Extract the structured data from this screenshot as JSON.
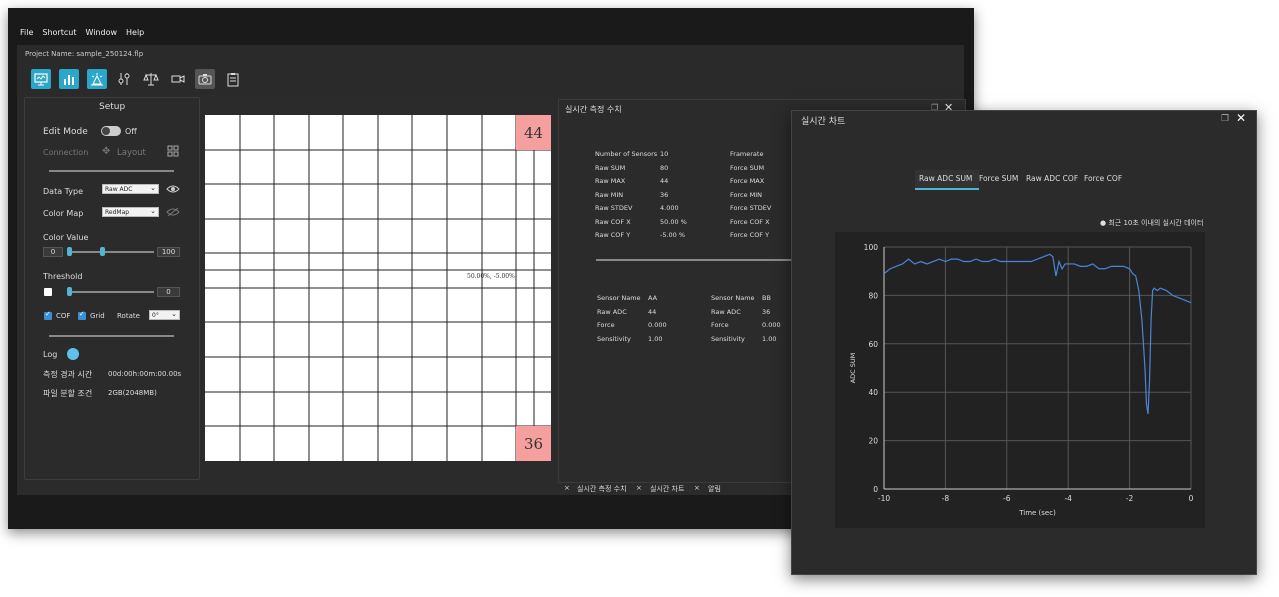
{
  "menu": [
    "File",
    "Shortcut",
    "Window",
    "Help"
  ],
  "project_name": "Project Name: sample_250124.flp",
  "toolbar": {
    "icons": [
      "monitor-icon",
      "bar-chart-icon",
      "sensor-icon",
      "sliders-icon",
      "scale-icon",
      "video-icon",
      "camera-icon",
      "clipboard-icon"
    ],
    "accent": "#2aa7c9"
  },
  "setup": {
    "title": "Setup",
    "edit_mode_label": "Edit Mode",
    "edit_mode_state": "Off",
    "connection_label": "Connection",
    "layout_label": "Layout",
    "data_type_label": "Data Type",
    "data_type_value": "Raw ADC",
    "color_map_label": "Color Map",
    "color_map_value": "RedMap",
    "color_value_label": "Color Value",
    "color_min": "0",
    "color_max": "100",
    "threshold_label": "Threshold",
    "threshold_value": "0",
    "cof_label": "COF",
    "grid_label": "Grid",
    "rotate_label": "Rotate",
    "rotate_value": "0°",
    "log_label": "Log",
    "elapsed_label": "측정 경과 시간",
    "elapsed_value": "00d:00h:00m:00.00s",
    "split_label": "파일 분할 조건",
    "split_value": "2GB(2048MB)"
  },
  "grid": {
    "top_value": "44",
    "bottom_value": "36",
    "cof_text": "50.00%, -5.00%"
  },
  "measure": {
    "title": "실시간 측정 수치",
    "left_rows": [
      {
        "k": "Number of Sensors",
        "v": "10"
      },
      {
        "k": "Raw SUM",
        "v": "80"
      },
      {
        "k": "Raw MAX",
        "v": "44"
      },
      {
        "k": "Raw MIN",
        "v": "36"
      },
      {
        "k": "Raw STDEV",
        "v": "4.000"
      },
      {
        "k": "Raw COF X",
        "v": "50.00 %"
      },
      {
        "k": "Raw COF Y",
        "v": "-5.00 %"
      }
    ],
    "right_rows": [
      "Framerate",
      "Force SUM",
      "Force MAX",
      "Force MIN",
      "Force STDEV",
      "Force COF X",
      "Force COF Y"
    ],
    "sensor_a": [
      {
        "k": "Sensor Name",
        "v": "AA"
      },
      {
        "k": "Raw ADC",
        "v": "44"
      },
      {
        "k": "Force",
        "v": "0.000"
      },
      {
        "k": "Sensitivity",
        "v": "1.00"
      }
    ],
    "sensor_b": [
      {
        "k": "Sensor Name",
        "v": "BB"
      },
      {
        "k": "Raw ADC",
        "v": "36"
      },
      {
        "k": "Force",
        "v": "0.000"
      },
      {
        "k": "Sensitivity",
        "v": "1.00"
      }
    ]
  },
  "bottom_tabs": [
    "실시간 측정 수치",
    "실시간 차트",
    "알림"
  ],
  "chart_window": {
    "title": "실시간 차트",
    "tabs": [
      "Raw ADC SUM",
      "Force SUM",
      "Raw ADC COF",
      "Force COF"
    ],
    "active_tab": "Raw ADC SUM",
    "legend": "● 최근 10초 이내의 실시간 데이터"
  },
  "chart_data": {
    "type": "line",
    "xlabel": "Time (sec)",
    "ylabel": "ADC SUM",
    "xlim": [
      -10,
      0
    ],
    "ylim": [
      0,
      100
    ],
    "xticks": [
      -10,
      -8,
      -6,
      -4,
      -2,
      0
    ],
    "yticks": [
      0,
      20,
      40,
      60,
      80,
      100
    ],
    "grid": true,
    "series": [
      {
        "color": "#4a86d8",
        "x": [
          -10,
          -9.8,
          -9.6,
          -9.4,
          -9.2,
          -9.0,
          -8.8,
          -8.6,
          -8.4,
          -8.2,
          -8.0,
          -7.8,
          -7.6,
          -7.4,
          -7.2,
          -7.0,
          -6.8,
          -6.6,
          -6.4,
          -6.2,
          -6.0,
          -5.8,
          -5.6,
          -5.4,
          -5.2,
          -5.0,
          -4.8,
          -4.6,
          -4.5,
          -4.4,
          -4.3,
          -4.2,
          -4.1,
          -4.0,
          -3.8,
          -3.6,
          -3.4,
          -3.2,
          -3.0,
          -2.8,
          -2.6,
          -2.4,
          -2.2,
          -2.0,
          -1.9,
          -1.8,
          -1.7,
          -1.6,
          -1.5,
          -1.45,
          -1.4,
          -1.35,
          -1.3,
          -1.25,
          -1.2,
          -1.1,
          -1.0,
          -0.8,
          -0.6,
          -0.4,
          -0.2,
          0
        ],
        "y": [
          89,
          91,
          92,
          93,
          95,
          93,
          94,
          93,
          94,
          95,
          94,
          95,
          95,
          94,
          94,
          95,
          94,
          94,
          95,
          94,
          94,
          94,
          94,
          94,
          94,
          95,
          96,
          97,
          96,
          88,
          94,
          91,
          93,
          93,
          93,
          92,
          92,
          93,
          91,
          91,
          92,
          92,
          92,
          91,
          89,
          88,
          82,
          70,
          50,
          35,
          31,
          45,
          70,
          82,
          83,
          82,
          83,
          82,
          80,
          79,
          78,
          77
        ]
      }
    ]
  }
}
